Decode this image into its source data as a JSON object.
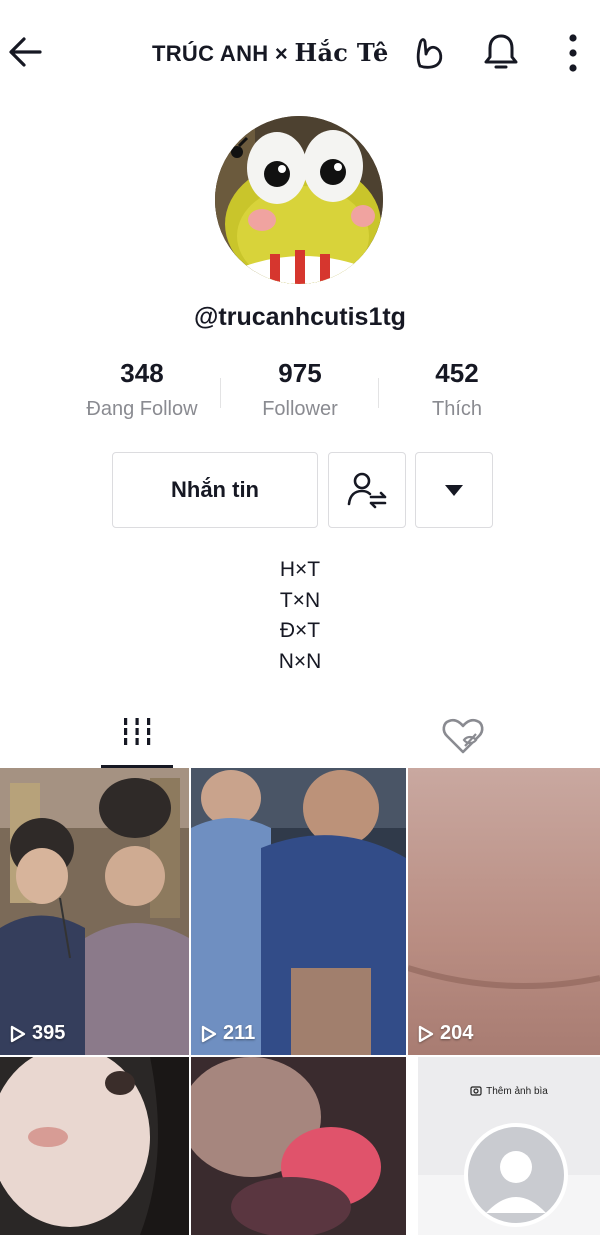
{
  "header": {
    "title_part1": "TRÚC ANH",
    "title_sep": "×",
    "title_part2": "Hắc Tê",
    "back_icon": "arrow-left-icon",
    "bell_icon": "bell-icon",
    "more_icon": "vertical-dots-icon"
  },
  "profile": {
    "username": "@trucanhcutis1tg"
  },
  "stats": [
    {
      "value": "348",
      "label": "Đang Follow"
    },
    {
      "value": "975",
      "label": "Follower"
    },
    {
      "value": "452",
      "label": "Thích"
    }
  ],
  "actions": {
    "message_label": "Nhắn tin"
  },
  "bio": [
    "H×T",
    "T×N",
    "Đ×T",
    "N×N"
  ],
  "tabs": {
    "videos_icon": "grid-icon",
    "liked_icon": "heart-hidden-icon"
  },
  "videos": [
    {
      "views": "395"
    },
    {
      "views": "211"
    },
    {
      "views": "204"
    }
  ],
  "cover_cell": {
    "label": "Thêm ảnh bìa"
  },
  "colors": {
    "text": "#161823",
    "secondary_text": "#8a8b91",
    "border": "#dcdcdf"
  }
}
